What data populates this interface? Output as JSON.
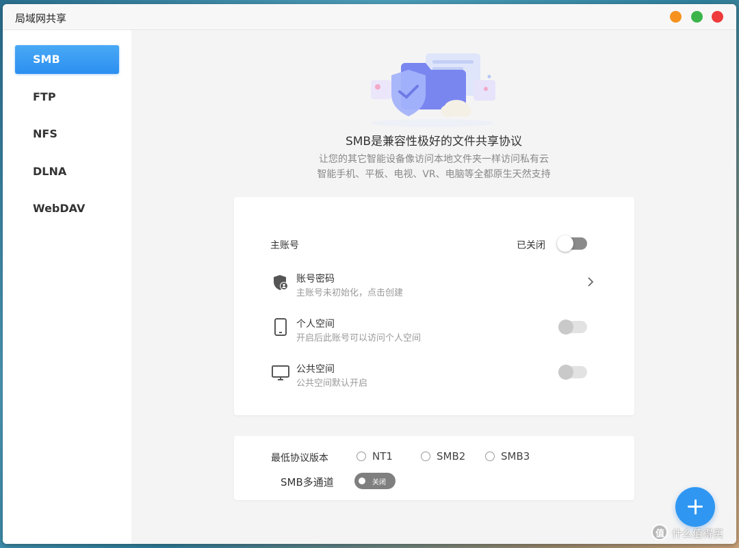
{
  "window": {
    "title": "局域网共享"
  },
  "sidebar": {
    "items": [
      {
        "label": "SMB",
        "active": true
      },
      {
        "label": "FTP",
        "active": false
      },
      {
        "label": "NFS",
        "active": false
      },
      {
        "label": "DLNA",
        "active": false
      },
      {
        "label": "WebDAV",
        "active": false
      }
    ]
  },
  "hero": {
    "title": "SMB是兼容性极好的文件共享协议",
    "subtitle_line1": "让您的其它智能设备像访问本地文件夹一样访问私有云",
    "subtitle_line2": "智能手机、平板、电视、VR、电脑等全都原生天然支持"
  },
  "main_account": {
    "label": "主账号",
    "status": "已关闭",
    "enabled": false
  },
  "rows": [
    {
      "icon": "shield-user-icon",
      "title": "账号密码",
      "subtitle": "主账号未初始化，点击创建"
    },
    {
      "icon": "phone-icon",
      "title": "个人空间",
      "subtitle": "开启后此账号可以访问个人空间",
      "enabled": false
    },
    {
      "icon": "monitor-icon",
      "title": "公共空间",
      "subtitle": "公共空间默认开启",
      "enabled": false
    }
  ],
  "protocol": {
    "min_version_label": "最低协议版本",
    "options": [
      "NT1",
      "SMB2",
      "SMB3"
    ],
    "multichannel_label": "SMB多通道",
    "multichannel_status": "关闭"
  },
  "watermark": {
    "text": "什么值得买",
    "glyph": "值"
  },
  "colors": {
    "accent": "#2f97f2",
    "active_nav": "#3a9cf3"
  }
}
